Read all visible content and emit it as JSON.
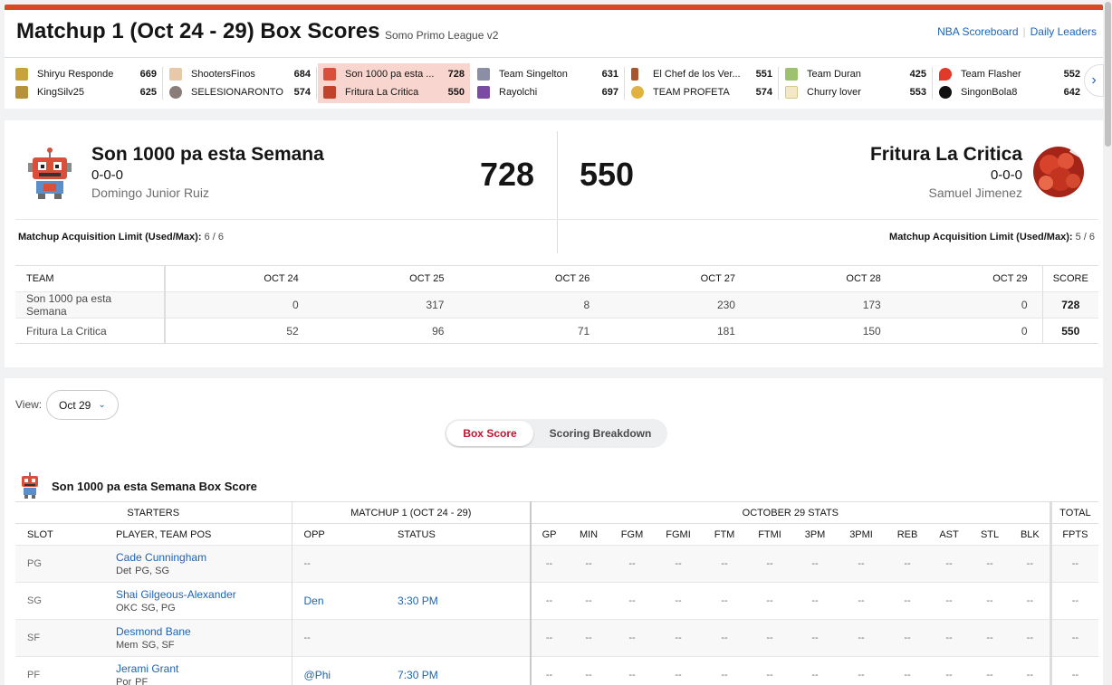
{
  "header": {
    "title": "Matchup 1 (Oct 24 - 29) Box Scores",
    "league": "Somo Primo League v2",
    "links": [
      "NBA Scoreboard",
      "Daily Leaders"
    ]
  },
  "matchups": [
    {
      "t1": {
        "name": "Shiryu Responde",
        "score": "669",
        "icon": "gold-team-icon"
      },
      "t2": {
        "name": "KingSilv25",
        "score": "625",
        "icon": "crown-team-icon"
      }
    },
    {
      "t1": {
        "name": "ShootersFinos",
        "score": "684",
        "icon": "player-team-icon"
      },
      "t2": {
        "name": "SELESIONARONTO",
        "score": "574",
        "icon": "globe-team-icon"
      }
    },
    {
      "t1": {
        "name": "Son 1000 pa esta ...",
        "score": "728",
        "icon": "robot-team-icon"
      },
      "t2": {
        "name": "Fritura La Critica",
        "score": "550",
        "icon": "food-team-icon"
      },
      "active": true
    },
    {
      "t1": {
        "name": "Team Singelton",
        "score": "631",
        "icon": "robot-team-icon"
      },
      "t2": {
        "name": "Rayolchi",
        "score": "697",
        "icon": "purple-team-icon"
      }
    },
    {
      "t1": {
        "name": "El Chef de los Ver...",
        "score": "551",
        "icon": "bottle-team-icon"
      },
      "t2": {
        "name": "TEAM PROFETA",
        "score": "574",
        "icon": "pizza-team-icon"
      }
    },
    {
      "t1": {
        "name": "Team Duran",
        "score": "425",
        "icon": "jar-team-icon"
      },
      "t2": {
        "name": "Churry lover",
        "score": "553",
        "icon": "sparkle-team-icon"
      }
    },
    {
      "t1": {
        "name": "Team Flasher",
        "score": "552",
        "icon": "flame-team-icon"
      },
      "t2": {
        "name": "SingonBola8",
        "score": "642",
        "icon": "eightball-team-icon"
      }
    }
  ],
  "home": {
    "name": "Son 1000 pa esta Semana",
    "record": "0-0-0",
    "owner": "Domingo Junior Ruiz",
    "score": "728",
    "acq_label": "Matchup Acquisition Limit (Used/Max):",
    "acq_value": "6 / 6"
  },
  "away": {
    "name": "Fritura La Critica",
    "record": "0-0-0",
    "owner": "Samuel Jimenez",
    "score": "550",
    "acq_label": "Matchup Acquisition Limit (Used/Max):",
    "acq_value": "5 / 6"
  },
  "daily": {
    "headers": [
      "TEAM",
      "OCT 24",
      "OCT 25",
      "OCT 26",
      "OCT 27",
      "OCT 28",
      "OCT 29",
      "SCORE"
    ],
    "rows": [
      [
        "Son 1000 pa esta Semana",
        "0",
        "317",
        "8",
        "230",
        "173",
        "0",
        "728"
      ],
      [
        "Fritura La Critica",
        "52",
        "96",
        "71",
        "181",
        "150",
        "0",
        "550"
      ]
    ]
  },
  "view": {
    "label": "View:",
    "selected": "Oct 29"
  },
  "toggle": {
    "active": "Box Score",
    "inactive": "Scoring Breakdown"
  },
  "boxscore": {
    "title": "Son 1000 pa esta Semana Box Score",
    "groups": [
      "STARTERS",
      "MATCHUP 1 (OCT 24 - 29)",
      "OCTOBER 29 STATS",
      "TOTAL"
    ],
    "columns": [
      "SLOT",
      "PLAYER, TEAM POS",
      "OPP",
      "STATUS",
      "GP",
      "MIN",
      "FGM",
      "FGMI",
      "FTM",
      "FTMI",
      "3PM",
      "3PMI",
      "REB",
      "AST",
      "STL",
      "BLK",
      "FPTS"
    ],
    "players": [
      {
        "slot": "PG",
        "name": "Cade Cunningham",
        "team": "Det",
        "pos": "PG, SG",
        "opp": "--",
        "status": ""
      },
      {
        "slot": "SG",
        "name": "Shai Gilgeous-Alexander",
        "team": "OKC",
        "pos": "SG, PG",
        "opp": "Den",
        "status": "3:30 PM"
      },
      {
        "slot": "SF",
        "name": "Desmond Bane",
        "team": "Mem",
        "pos": "SG, SF",
        "opp": "--",
        "status": ""
      },
      {
        "slot": "PF",
        "name": "Jerami Grant",
        "team": "Por",
        "pos": "PF",
        "opp": "@Phi",
        "status": "7:30 PM"
      }
    ],
    "empty_stat": "--"
  },
  "colors": {
    "accent": "#d94a23",
    "link": "#1d64b3",
    "active_toggle": "#c8102e",
    "active_matchup_bg": "#f8d6cf"
  }
}
